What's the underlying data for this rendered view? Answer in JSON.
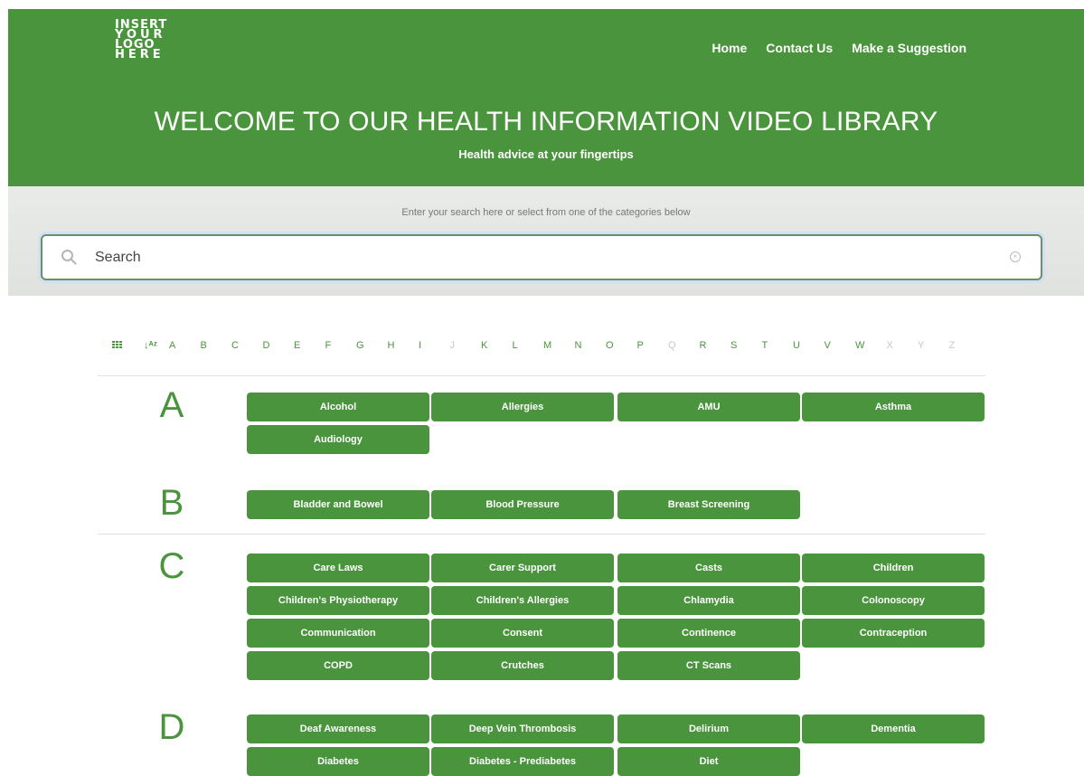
{
  "header": {
    "logo": [
      "INSERT",
      "YOUR",
      "LOGO",
      "HERE"
    ],
    "nav": [
      "Home",
      "Contact Us",
      "Make a Suggestion"
    ],
    "title": "WELCOME TO OUR HEALTH INFORMATION VIDEO LIBRARY",
    "subtitle": "Health advice at your fingertips"
  },
  "search": {
    "hint": "Enter your search here or select from one of the categories below",
    "placeholder": "Search",
    "value": ""
  },
  "alphabet": {
    "letters": [
      "A",
      "B",
      "C",
      "D",
      "E",
      "F",
      "G",
      "H",
      "I",
      "J",
      "K",
      "L",
      "M",
      "N",
      "O",
      "P",
      "Q",
      "R",
      "S",
      "T",
      "U",
      "V",
      "W",
      "X",
      "Y",
      "Z"
    ],
    "disabled": [
      "J",
      "Q",
      "X",
      "Y",
      "Z"
    ]
  },
  "sections": [
    {
      "letter": "A",
      "items": [
        "Alcohol",
        "Allergies",
        "AMU",
        "Asthma",
        "Audiology"
      ]
    },
    {
      "letter": "B",
      "items": [
        "Bladder and Bowel",
        "Blood Pressure",
        "Breast Screening"
      ]
    },
    {
      "letter": "C",
      "items": [
        "Care Laws",
        "Carer Support",
        "Casts",
        "Children",
        "Children's Physiotherapy",
        "Children's Allergies",
        "Chlamydia",
        "Colonoscopy",
        "Communication",
        "Consent",
        "Continence",
        "Contraception",
        "COPD",
        "Crutches",
        "CT Scans"
      ]
    },
    {
      "letter": "D",
      "items": [
        "Deaf Awareness",
        "Deep Vein Thrombosis",
        "Delirium",
        "Dementia",
        "Diabetes",
        "Diabetes - Prediabetes",
        "Diet"
      ]
    }
  ],
  "colors": {
    "brand": "#4a943d",
    "disabled_letter": "#c8c8c8"
  }
}
